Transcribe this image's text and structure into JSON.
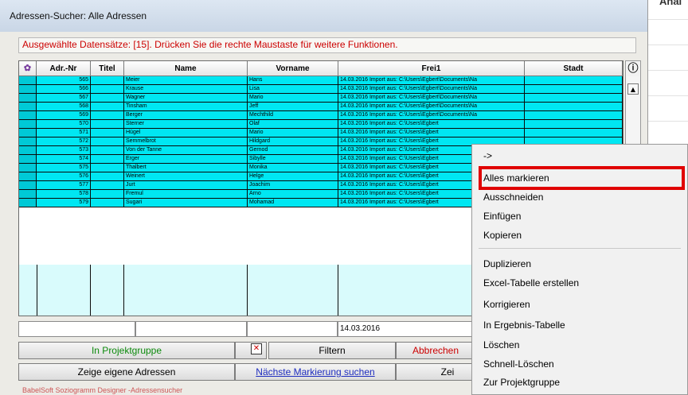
{
  "window_title": "Adressen-Sucher:  Alle Adressen",
  "status_text": "Ausgewählte Datensätze: [15]. Drücken Sie die rechte Maustaste für weitere Funktionen.",
  "background_app_label": "Anal",
  "columns": [
    "",
    "Adr.-Nr",
    "Titel",
    "Name",
    "Vorname",
    "Frei1",
    "Stadt"
  ],
  "rows": [
    {
      "nr": "565",
      "titel": "",
      "name": "Meier",
      "vorname": "Hans",
      "frei1": "14.03.2016 Import aus: C:\\Users\\Egbert\\Documents\\Na",
      "stadt": ""
    },
    {
      "nr": "566",
      "titel": "",
      "name": "Krause",
      "vorname": "Lisa",
      "frei1": "14.03.2016 Import aus: C:\\Users\\Egbert\\Documents\\Na",
      "stadt": ""
    },
    {
      "nr": "567",
      "titel": "",
      "name": "Wagner",
      "vorname": "Mario",
      "frei1": "14.03.2016 Import aus: C:\\Users\\Egbert\\Documents\\Na",
      "stadt": ""
    },
    {
      "nr": "568",
      "titel": "",
      "name": "Tinsham",
      "vorname": "Jeff",
      "frei1": "14.03.2016 Import aus: C:\\Users\\Egbert\\Documents\\Na",
      "stadt": ""
    },
    {
      "nr": "569",
      "titel": "",
      "name": "Berger",
      "vorname": "Mechthild",
      "frei1": "14.03.2016 Import aus: C:\\Users\\Egbert\\Documents\\Na",
      "stadt": ""
    },
    {
      "nr": "570",
      "titel": "",
      "name": "Sterner",
      "vorname": "Olaf",
      "frei1": "14.03.2016 Import aus: C:\\Users\\Egbert",
      "stadt": ""
    },
    {
      "nr": "571",
      "titel": "",
      "name": "Hügel",
      "vorname": "Mario",
      "frei1": "14.03.2016 Import aus: C:\\Users\\Egbert",
      "stadt": ""
    },
    {
      "nr": "572",
      "titel": "",
      "name": "Semmelbrot",
      "vorname": "Hildgard",
      "frei1": "14.03.2016 Import aus: C:\\Users\\Egbert",
      "stadt": ""
    },
    {
      "nr": "573",
      "titel": "",
      "name": "Von der Tanne",
      "vorname": "Gernod",
      "frei1": "14.03.2016 Import aus: C:\\Users\\Egbert",
      "stadt": ""
    },
    {
      "nr": "574",
      "titel": "",
      "name": "Erger",
      "vorname": "Sibylle",
      "frei1": "14.03.2016 Import aus: C:\\Users\\Egbert",
      "stadt": ""
    },
    {
      "nr": "575",
      "titel": "",
      "name": "Thalbert",
      "vorname": "Monika",
      "frei1": "14.03.2016 Import aus: C:\\Users\\Egbert",
      "stadt": ""
    },
    {
      "nr": "576",
      "titel": "",
      "name": "Weinert",
      "vorname": "Helge",
      "frei1": "14.03.2016 Import aus: C:\\Users\\Egbert",
      "stadt": ""
    },
    {
      "nr": "577",
      "titel": "",
      "name": "Jurt",
      "vorname": "Joachim",
      "frei1": "14.03.2016 Import aus: C:\\Users\\Egbert",
      "stadt": ""
    },
    {
      "nr": "578",
      "titel": "",
      "name": "Fremul",
      "vorname": "Arno",
      "frei1": "14.03.2016 Import aus: C:\\Users\\Egbert",
      "stadt": ""
    },
    {
      "nr": "579",
      "titel": "",
      "name": "Sugari",
      "vorname": "Mohamad",
      "frei1": "14.03.2016 Import aus: C:\\Users\\Egbert",
      "stadt": ""
    }
  ],
  "filter_row": {
    "frei1": "14.03.2016"
  },
  "buttons": {
    "in_projektgruppe": "In Projektgruppe",
    "filtern": "Filtern",
    "abbrechen": "Abbrechen",
    "zeige_eigene": "Zeige eigene Adressen",
    "naechste_markierung": "Nächste Markierung suchen",
    "zeige_partial": "Zei"
  },
  "footer_text": "BabelSoft Soziogramm Designer -Adressensucher",
  "context_menu": {
    "items": [
      {
        "label": "->"
      },
      {
        "label": "Alles markieren"
      },
      {
        "label": "Ausschneiden"
      },
      {
        "label": "Einfügen"
      },
      {
        "label": "Kopieren"
      },
      {
        "label": "Duplizieren"
      },
      {
        "label": "Excel-Tabelle erstellen"
      },
      {
        "label": "Korrigieren"
      },
      {
        "label": "In Ergebnis-Tabelle"
      },
      {
        "label": "Löschen"
      },
      {
        "label": "Schnell-Löschen"
      },
      {
        "label": "Zur Projektgruppe"
      }
    ]
  },
  "colors": {
    "row_bg": "#00e7f2",
    "status_text": "#cc0000",
    "highlight_border": "#e00000"
  }
}
